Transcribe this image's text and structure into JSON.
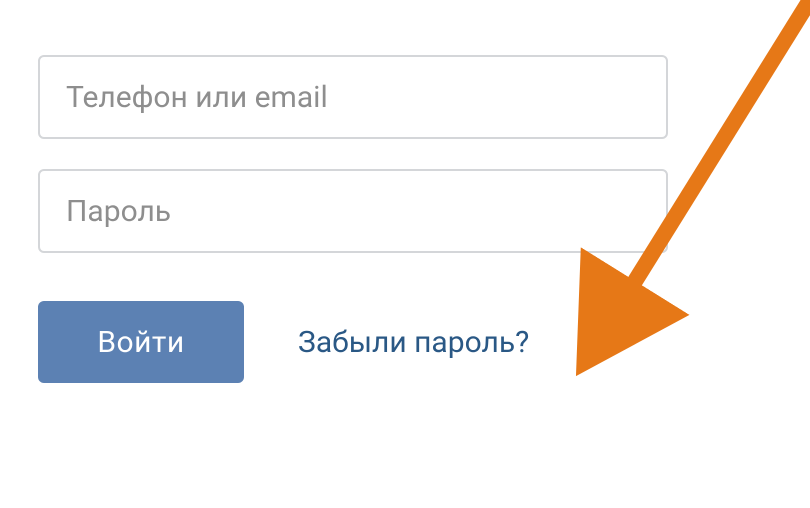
{
  "login_form": {
    "username_placeholder": "Телефон или email",
    "username_value": "",
    "password_placeholder": "Пароль",
    "password_value": "",
    "submit_label": "Войти",
    "forgot_label": "Забыли пароль?"
  },
  "colors": {
    "button_bg": "#5c81b3",
    "link_color": "#2a5885",
    "input_border": "#d4d6d9",
    "placeholder": "#8e8e8e",
    "arrow": "#e67817"
  }
}
